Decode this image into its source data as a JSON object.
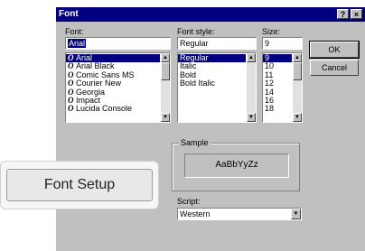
{
  "window": {
    "title": "Font",
    "help_button": "?",
    "close_button": "×"
  },
  "font": {
    "label": "Font:",
    "value": "Arial",
    "items": [
      {
        "label": "Arial",
        "selected": true
      },
      {
        "label": "Arial Black"
      },
      {
        "label": "Comic Sans MS"
      },
      {
        "label": "Courier New"
      },
      {
        "label": "Georgia"
      },
      {
        "label": "Impact"
      },
      {
        "label": "Lucida Console"
      }
    ],
    "item_icon": "O"
  },
  "font_style": {
    "label": "Font style:",
    "value": "Regular",
    "items": [
      {
        "label": "Regular",
        "selected": true
      },
      {
        "label": "Italic"
      },
      {
        "label": "Bold"
      },
      {
        "label": "Bold Italic"
      }
    ]
  },
  "size": {
    "label": "Size:",
    "value": "9",
    "items": [
      {
        "label": "9",
        "selected": true
      },
      {
        "label": "10"
      },
      {
        "label": "11"
      },
      {
        "label": "12"
      },
      {
        "label": "14"
      },
      {
        "label": "16"
      },
      {
        "label": "18"
      }
    ]
  },
  "buttons": {
    "ok": "OK",
    "cancel": "Cancel"
  },
  "sample": {
    "label": "Sample",
    "text": "AaBbYyZz"
  },
  "script": {
    "label": "Script:",
    "value": "Western"
  },
  "overlay": {
    "label": "Font Setup"
  },
  "colors": {
    "title_bar": "#000080",
    "selection": "#000080",
    "dialog": "#c0c0c0"
  }
}
